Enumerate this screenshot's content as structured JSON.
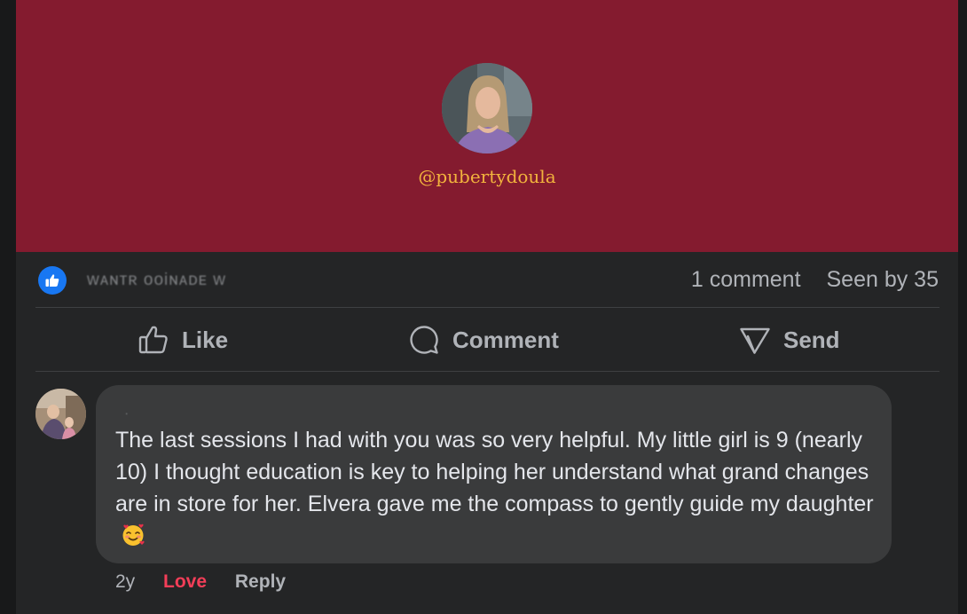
{
  "post": {
    "profile_handle": "@pubertydoula",
    "banner_color": "#841b2f",
    "handle_color": "#f2b33d"
  },
  "stats": {
    "reaction_icon": "like-icon",
    "reactors_text": "ᴡᴀɴᴛʀ ooiɴᴀᴅᴇ ᴡ",
    "comment_count": "1 comment",
    "seen_by": "Seen by 35"
  },
  "actions": {
    "like_label": "Like",
    "comment_label": "Comment",
    "send_label": "Send"
  },
  "comment": {
    "author_name": ".",
    "text": "The last sessions I had with you was so very helpful. My little girl is 9 (nearly 10) I thought education is key to helping her understand what grand changes are in store for her. Elvera gave me the compass to gently guide my daughter",
    "emoji": "smiling-face-with-hearts",
    "time": "2y",
    "love_label": "Love",
    "reply_label": "Reply"
  },
  "colors": {
    "accent_blue": "#1877f2",
    "love_red": "#f33e58",
    "card_bg": "#242526",
    "bubble_bg": "#3a3b3c"
  }
}
